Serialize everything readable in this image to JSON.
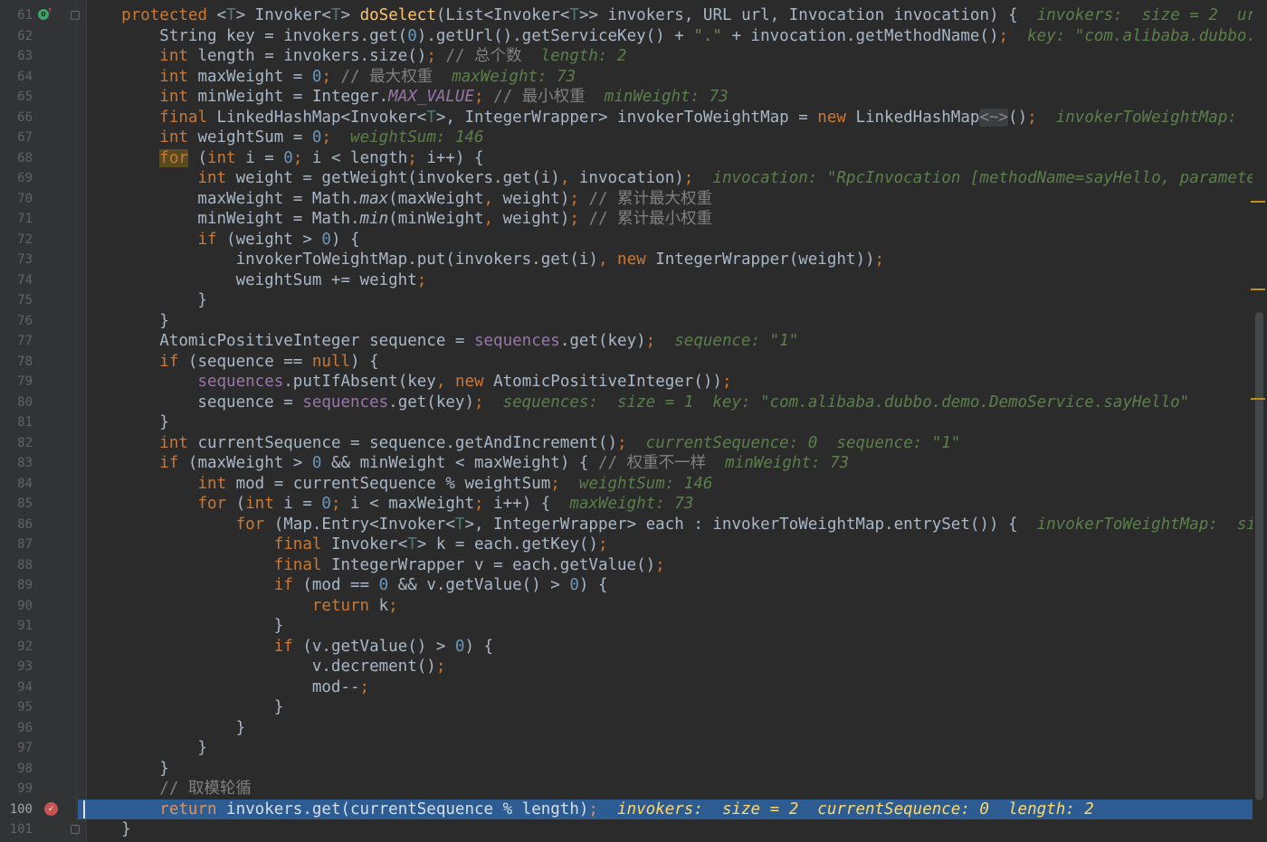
{
  "colors": {
    "background": "#2b2b2b",
    "gutter": "#313335",
    "keyword": "#cc7832",
    "number": "#6897bb",
    "string": "#6a8759",
    "field": "#9876aa",
    "method_decl": "#ffc66d",
    "comment": "#808080",
    "inline_hint": "#5b7f4a",
    "current_line": "#2d5c92",
    "breakpoint": "#c75450"
  },
  "icons": {
    "override": "override-icon",
    "breakpoint": "breakpoint-icon",
    "fold": "fold-icon"
  },
  "current_line_number": 100,
  "line_numbers": [
    "61",
    "62",
    "63",
    "64",
    "65",
    "66",
    "67",
    "68",
    "69",
    "70",
    "71",
    "72",
    "73",
    "74",
    "75",
    "76",
    "77",
    "78",
    "79",
    "80",
    "81",
    "82",
    "83",
    "84",
    "85",
    "86",
    "87",
    "88",
    "89",
    "90",
    "91",
    "92",
    "93",
    "94",
    "95",
    "96",
    "97",
    "98",
    "99",
    "100",
    "101"
  ],
  "lines": [
    [
      [
        "    ",
        ""
      ],
      [
        "protected",
        "kw"
      ],
      [
        " <",
        ""
      ],
      [
        "T",
        "gen"
      ],
      [
        "> Invoker<",
        ""
      ],
      [
        "T",
        "gen"
      ],
      [
        "> ",
        ""
      ],
      [
        "doSelect",
        "fn"
      ],
      [
        "(List<Invoker<",
        ""
      ],
      [
        "T",
        "gen"
      ],
      [
        ">> invokers, URL url, Invocation invocation) {  ",
        ""
      ],
      [
        "invokers:  size = 2  url",
        "hint"
      ]
    ],
    [
      [
        "        String key = invokers.get(",
        ""
      ],
      [
        "0",
        "num"
      ],
      [
        ").getUrl().getServiceKey() + ",
        ""
      ],
      [
        "\".\"",
        "str"
      ],
      [
        " + invocation.getMethodName()",
        ""
      ],
      [
        ";",
        "kw"
      ],
      [
        "  ",
        ""
      ],
      [
        "key: \"com.alibaba.dubbo.",
        "hint"
      ]
    ],
    [
      [
        "        ",
        ""
      ],
      [
        "int",
        "kw"
      ],
      [
        " length = invokers.size()",
        ""
      ],
      [
        ";",
        "kw"
      ],
      [
        " ",
        ""
      ],
      [
        "// 总个数",
        "cmt"
      ],
      [
        "  ",
        ""
      ],
      [
        "length: 2",
        "hint"
      ]
    ],
    [
      [
        "        ",
        ""
      ],
      [
        "int",
        "kw"
      ],
      [
        " maxWeight = ",
        ""
      ],
      [
        "0",
        "num"
      ],
      [
        ";",
        "kw"
      ],
      [
        " ",
        ""
      ],
      [
        "// 最大权重",
        "cmt"
      ],
      [
        "  ",
        ""
      ],
      [
        "maxWeight: 73",
        "hint"
      ]
    ],
    [
      [
        "        ",
        ""
      ],
      [
        "int",
        "kw"
      ],
      [
        " minWeight = Integer.",
        ""
      ],
      [
        "MAX_VALUE",
        "cst"
      ],
      [
        ";",
        "kw"
      ],
      [
        " ",
        ""
      ],
      [
        "// 最小权重",
        "cmt"
      ],
      [
        "  ",
        ""
      ],
      [
        "minWeight: 73",
        "hint"
      ]
    ],
    [
      [
        "        ",
        ""
      ],
      [
        "final",
        "kw"
      ],
      [
        " LinkedHashMap<Invoker<",
        ""
      ],
      [
        "T",
        "gen"
      ],
      [
        ">, IntegerWrapper> invokerToWeightMap = ",
        ""
      ],
      [
        "new",
        "kw"
      ],
      [
        " LinkedHashMap",
        ""
      ],
      [
        "<~>",
        "fold"
      ],
      [
        "()",
        ""
      ],
      [
        ";",
        "kw"
      ],
      [
        "  ",
        ""
      ],
      [
        "invokerToWeightMap:",
        "hint"
      ]
    ],
    [
      [
        "        ",
        ""
      ],
      [
        "int",
        "kw"
      ],
      [
        " weightSum = ",
        ""
      ],
      [
        "0",
        "num"
      ],
      [
        ";",
        "kw"
      ],
      [
        "  ",
        ""
      ],
      [
        "weightSum: 146",
        "hint"
      ]
    ],
    [
      [
        "        ",
        ""
      ],
      [
        "for",
        "kwbox"
      ],
      [
        " (",
        ""
      ],
      [
        "int",
        "kw"
      ],
      [
        " i = ",
        ""
      ],
      [
        "0",
        "num"
      ],
      [
        ";",
        "kw"
      ],
      [
        " i < length",
        ""
      ],
      [
        ";",
        "kw"
      ],
      [
        " i++) {",
        ""
      ]
    ],
    [
      [
        "            ",
        ""
      ],
      [
        "int",
        "kw"
      ],
      [
        " weight = getWeight(invokers.get(i)",
        ""
      ],
      [
        ",",
        "kw"
      ],
      [
        " invocation)",
        ""
      ],
      [
        ";",
        "kw"
      ],
      [
        "  ",
        ""
      ],
      [
        "invocation: \"RpcInvocation [methodName=sayHello, paramete",
        "hint"
      ]
    ],
    [
      [
        "            maxWeight = Math.",
        ""
      ],
      [
        "max",
        "sfn"
      ],
      [
        "(maxWeight",
        ""
      ],
      [
        ",",
        "kw"
      ],
      [
        " weight)",
        ""
      ],
      [
        ";",
        "kw"
      ],
      [
        " ",
        ""
      ],
      [
        "// 累计最大权重",
        "cmt"
      ]
    ],
    [
      [
        "            minWeight = Math.",
        ""
      ],
      [
        "min",
        "sfn"
      ],
      [
        "(minWeight",
        ""
      ],
      [
        ",",
        "kw"
      ],
      [
        " weight)",
        ""
      ],
      [
        ";",
        "kw"
      ],
      [
        " ",
        ""
      ],
      [
        "// 累计最小权重",
        "cmt"
      ]
    ],
    [
      [
        "            ",
        ""
      ],
      [
        "if",
        "kw"
      ],
      [
        " (weight > ",
        ""
      ],
      [
        "0",
        "num"
      ],
      [
        ") {",
        ""
      ]
    ],
    [
      [
        "                invokerToWeightMap.put(invokers.get(i)",
        ""
      ],
      [
        ",",
        "kw"
      ],
      [
        " ",
        ""
      ],
      [
        "new",
        "kw"
      ],
      [
        " IntegerWrapper(weight))",
        ""
      ],
      [
        ";",
        "kw"
      ]
    ],
    [
      [
        "                weightSum += weight",
        ""
      ],
      [
        ";",
        "kw"
      ]
    ],
    [
      [
        "            }",
        ""
      ]
    ],
    [
      [
        "        }",
        ""
      ]
    ],
    [
      [
        "        AtomicPositiveInteger sequence = ",
        ""
      ],
      [
        "sequences",
        "fld"
      ],
      [
        ".get(key)",
        ""
      ],
      [
        ";",
        "kw"
      ],
      [
        "  ",
        ""
      ],
      [
        "sequence: \"1\"",
        "hint"
      ]
    ],
    [
      [
        "        ",
        ""
      ],
      [
        "if",
        "kw"
      ],
      [
        " (sequence == ",
        ""
      ],
      [
        "null",
        "kw"
      ],
      [
        ") {",
        ""
      ]
    ],
    [
      [
        "            ",
        ""
      ],
      [
        "sequences",
        "fld"
      ],
      [
        ".putIfAbsent(key",
        ""
      ],
      [
        ",",
        "kw"
      ],
      [
        " ",
        ""
      ],
      [
        "new",
        "kw"
      ],
      [
        " AtomicPositiveInteger())",
        ""
      ],
      [
        ";",
        "kw"
      ]
    ],
    [
      [
        "            sequence = ",
        ""
      ],
      [
        "sequences",
        "fld"
      ],
      [
        ".get(key)",
        ""
      ],
      [
        ";",
        "kw"
      ],
      [
        "  ",
        ""
      ],
      [
        "sequences:  size = 1  key: \"com.alibaba.dubbo.demo.DemoService.sayHello\"",
        "hint"
      ]
    ],
    [
      [
        "        }",
        ""
      ]
    ],
    [
      [
        "        ",
        ""
      ],
      [
        "int",
        "kw"
      ],
      [
        " currentSequence = sequence.getAndIncrement()",
        ""
      ],
      [
        ";",
        "kw"
      ],
      [
        "  ",
        ""
      ],
      [
        "currentSequence: 0  sequence: \"1\"",
        "hint"
      ]
    ],
    [
      [
        "        ",
        ""
      ],
      [
        "if",
        "kw"
      ],
      [
        " (maxWeight > ",
        ""
      ],
      [
        "0",
        "num"
      ],
      [
        " && minWeight < maxWeight) { ",
        ""
      ],
      [
        "// 权重不一样",
        "cmt"
      ],
      [
        "  ",
        ""
      ],
      [
        "minWeight: 73",
        "hint"
      ]
    ],
    [
      [
        "            ",
        ""
      ],
      [
        "int",
        "kw"
      ],
      [
        " mod = currentSequence % weightSum",
        ""
      ],
      [
        ";",
        "kw"
      ],
      [
        "  ",
        ""
      ],
      [
        "weightSum: 146",
        "hint"
      ]
    ],
    [
      [
        "            ",
        ""
      ],
      [
        "for",
        "kw"
      ],
      [
        " (",
        ""
      ],
      [
        "int",
        "kw"
      ],
      [
        " i = ",
        ""
      ],
      [
        "0",
        "num"
      ],
      [
        ";",
        "kw"
      ],
      [
        " i < maxWeight",
        ""
      ],
      [
        ";",
        "kw"
      ],
      [
        " i++) {  ",
        ""
      ],
      [
        "maxWeight: 73",
        "hint"
      ]
    ],
    [
      [
        "                ",
        ""
      ],
      [
        "for",
        "kw"
      ],
      [
        " (Map.Entry<Invoker<",
        ""
      ],
      [
        "T",
        "gen"
      ],
      [
        ">, IntegerWrapper> each : invokerToWeightMap.entrySet()) {  ",
        ""
      ],
      [
        "invokerToWeightMap:  si",
        "hint"
      ]
    ],
    [
      [
        "                    ",
        ""
      ],
      [
        "final",
        "kw"
      ],
      [
        " Invoker<",
        ""
      ],
      [
        "T",
        "gen"
      ],
      [
        "> k = each.getKey()",
        ""
      ],
      [
        ";",
        "kw"
      ]
    ],
    [
      [
        "                    ",
        ""
      ],
      [
        "final",
        "kw"
      ],
      [
        " IntegerWrapper v = each.getValue()",
        ""
      ],
      [
        ";",
        "kw"
      ]
    ],
    [
      [
        "                    ",
        ""
      ],
      [
        "if",
        "kw"
      ],
      [
        " (mod == ",
        ""
      ],
      [
        "0",
        "num"
      ],
      [
        " && v.getValue() > ",
        ""
      ],
      [
        "0",
        "num"
      ],
      [
        ") {",
        ""
      ]
    ],
    [
      [
        "                        ",
        ""
      ],
      [
        "return",
        "kw"
      ],
      [
        " k",
        ""
      ],
      [
        ";",
        "kw"
      ]
    ],
    [
      [
        "                    }",
        ""
      ]
    ],
    [
      [
        "                    ",
        ""
      ],
      [
        "if",
        "kw"
      ],
      [
        " (v.getValue() > ",
        ""
      ],
      [
        "0",
        "num"
      ],
      [
        ") {",
        ""
      ]
    ],
    [
      [
        "                        v.decrement()",
        ""
      ],
      [
        ";",
        "kw"
      ]
    ],
    [
      [
        "                        mod--",
        ""
      ],
      [
        ";",
        "kw"
      ]
    ],
    [
      [
        "                    }",
        ""
      ]
    ],
    [
      [
        "                }",
        ""
      ]
    ],
    [
      [
        "            }",
        ""
      ]
    ],
    [
      [
        "        }",
        ""
      ]
    ],
    [
      [
        "        ",
        ""
      ],
      [
        "// 取模轮循",
        "cmt"
      ]
    ],
    [
      [
        "        ",
        ""
      ],
      [
        "return",
        "kw"
      ],
      [
        " invokers.get(currentSequence % length)",
        ""
      ],
      [
        ";",
        "kw"
      ],
      [
        "  ",
        ""
      ],
      [
        "invokers:  size = 2  currentSequence: 0  length: 2",
        "hint"
      ]
    ],
    [
      [
        "    }",
        ""
      ]
    ]
  ]
}
